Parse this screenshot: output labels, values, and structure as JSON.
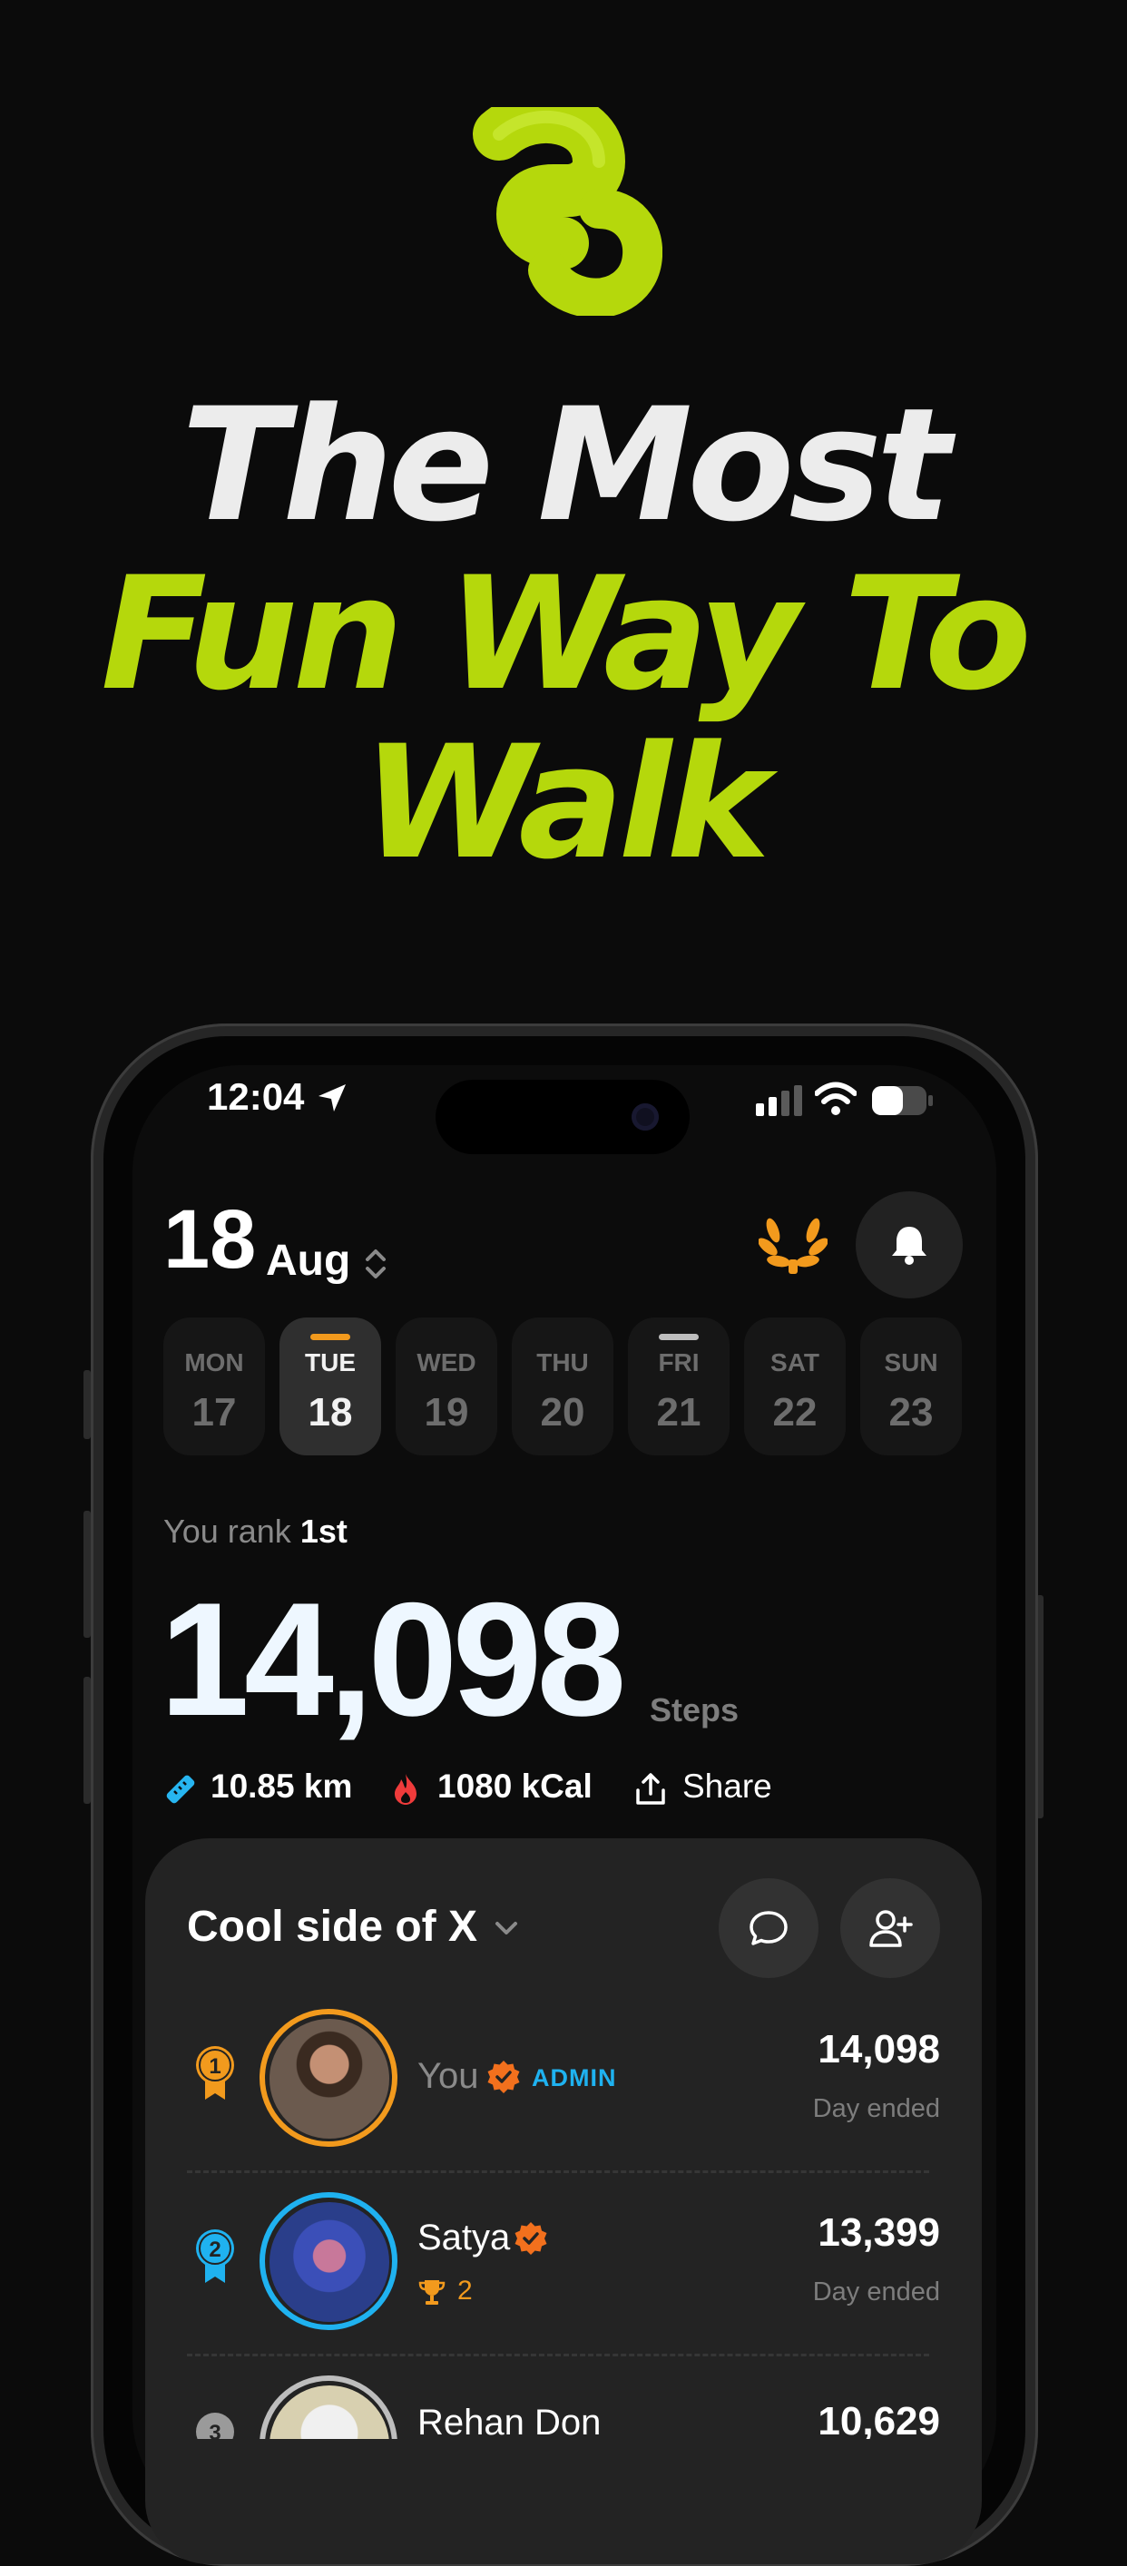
{
  "headline": {
    "line1": "The Most",
    "line2": "Fun Way To",
    "line3": "Walk"
  },
  "colors": {
    "accent": "#b5d80c",
    "orange": "#f29a1d",
    "blue": "#1fb2f0"
  },
  "status_bar": {
    "time": "12:04"
  },
  "date_header": {
    "day": "18",
    "month": "Aug"
  },
  "week": [
    {
      "name": "MON",
      "date": "17"
    },
    {
      "name": "TUE",
      "date": "18",
      "selected": true,
      "indicator": "orange"
    },
    {
      "name": "WED",
      "date": "19"
    },
    {
      "name": "THU",
      "date": "20"
    },
    {
      "name": "FRI",
      "date": "21",
      "indicator": "gray"
    },
    {
      "name": "SAT",
      "date": "22"
    },
    {
      "name": "SUN",
      "date": "23"
    }
  ],
  "rank": {
    "prefix": "You rank",
    "value": "1st"
  },
  "steps": {
    "value": "14,098",
    "label": "Steps"
  },
  "metrics": {
    "distance": "10.85 km",
    "calories": "1080 kCal",
    "share_label": "Share"
  },
  "group": {
    "title": "Cool side of X",
    "leaderboard": [
      {
        "rank": "1",
        "name": "You",
        "badge": "ADMIN",
        "steps": "14,098",
        "status": "Day ended"
      },
      {
        "rank": "2",
        "name": "Satya",
        "trophies": "2",
        "steps": "13,399",
        "status": "Day ended"
      },
      {
        "rank": "3",
        "name": "Rehan Don",
        "steps": "10,629"
      }
    ]
  }
}
